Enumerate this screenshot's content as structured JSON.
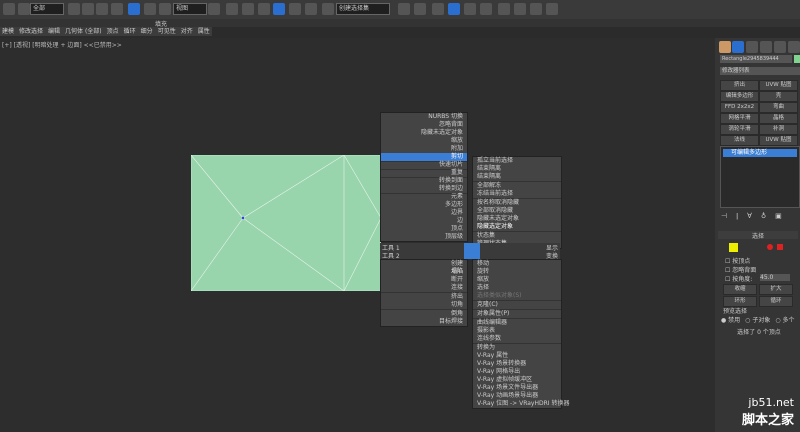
{
  "toolbar": {
    "selection_filter": "全部",
    "ref_coord": "视图",
    "named_selection": "创建选择集"
  },
  "ribbon": {
    "header": "填充",
    "items": [
      "建模",
      "修改选择",
      "编辑",
      "几何体 (全部)",
      "顶点",
      "循环",
      "细分",
      "可见性",
      "对齐",
      "属性"
    ]
  },
  "viewport": {
    "label": "[+] [透视] [明暗处理 + 边面] <<已禁用>>"
  },
  "quad_menu": {
    "top_left": [
      "NURBS 切换",
      "忽略背面",
      "隐藏未选定对象",
      "缩放",
      "附加",
      "剪切",
      "快速切片",
      "重复",
      "转换到面",
      "转换到边",
      "元素",
      "多边形",
      "边界",
      "边",
      "顶点",
      "顶层级"
    ],
    "top_left_highlight": "剪切",
    "top_right": [
      "结束隔离",
      "孤立当前选择",
      "结束隔离",
      "全部解冻",
      "冻结当前选择",
      "按名称取消隐藏",
      "全部取消隐藏",
      "隐藏未选定对象",
      "隐藏选定对象",
      "状态集",
      "管理状态集"
    ],
    "tool1_label": "工具 1",
    "tool2_label": "工具 2",
    "display_label": "显示",
    "transform_label": "变换",
    "bottom_left": [
      "创建",
      "塌陷",
      "断开",
      "连接",
      "挤出",
      "切角",
      "倒角",
      "目标焊接"
    ],
    "bottom_right": [
      "移动",
      "旋转",
      "缩放",
      "选择",
      "选择类似对象(S)",
      "克隆(C)",
      "对象属性(P)",
      "曲线编辑器",
      "摄影表",
      "连线参数",
      "转换为",
      "V-Ray 属性",
      "V-Ray 场景转换器",
      "V-Ray 网格导出",
      "V-Ray 虚拟帧缓冲区",
      "V-Ray 场景文件导出器",
      "V-Ray 动画场景导出器",
      "V-Ray 位图 -> VRayHDRI 转换器"
    ]
  },
  "panel": {
    "object_name": "Rectangle2945839444",
    "modifier_list": "修改器列表",
    "modifier_buttons": [
      "挤出",
      "UVW 贴图",
      "编辑多边形",
      "壳",
      "FFD 2x2x2",
      "弯曲",
      "网格平滑",
      "晶格",
      "涡轮平滑",
      "补洞",
      "法线",
      "UVW 贴图"
    ],
    "stack_item": "可编辑多边形",
    "selection_title": "选择",
    "by_vertex": "按顶点",
    "ignore_backfacing": "忽略背面",
    "by_angle": "按角度:",
    "angle_value": "45.0",
    "shrink": "收缩",
    "grow": "扩大",
    "ring": "环形",
    "loop": "循环",
    "preview_title": "预览选择",
    "preview_options": [
      "禁用",
      "子对象",
      "多个"
    ],
    "status": "选择了 0 个顶点"
  },
  "watermark": {
    "site": "jb51.net",
    "name": "脚本之家"
  },
  "colors": {
    "mesh": "#98d4ac",
    "highlight": "#3a7fd5",
    "object_color": "#7fd48f"
  }
}
